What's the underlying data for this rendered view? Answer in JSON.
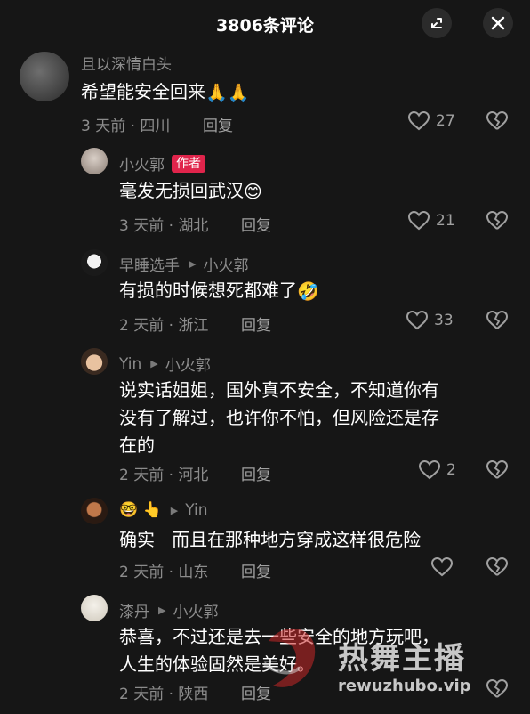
{
  "header": {
    "title": "3806条评论"
  },
  "comments": [
    {
      "user": "且以深情白头",
      "text": "希望能安全回来",
      "emoji": "🙏🙏",
      "meta": "3 天前 · 四川",
      "reply": "回复",
      "likes": "27"
    },
    {
      "user": "小火郭",
      "badge": "作者",
      "text": "毫发无损回武汉",
      "emoji": "😊",
      "meta": "3 天前 · 湖北",
      "reply": "回复",
      "likes": "21"
    },
    {
      "user": "早睡选手",
      "reply_to": "小火郭",
      "text": "有损的时候想死都难了",
      "emoji": "🤣",
      "meta": "2 天前 · 浙江",
      "reply": "回复",
      "likes": "33"
    },
    {
      "user": "Yin",
      "reply_to": "小火郭",
      "text_lines": [
        "说实话姐姐，国外真不安全，不知道你有",
        "没有了解过，也许你不怕，但风险还是存",
        "在的"
      ],
      "meta": "2 天前 · 河北",
      "reply": "回复",
      "likes": "2"
    },
    {
      "user": "🤓 👆",
      "reply_to": "Yin",
      "text": "确实   而且在那种地方穿成这样很危险",
      "meta": "2 天前 · 山东",
      "reply": "回复",
      "likes": ""
    },
    {
      "user": "漆丹",
      "reply_to": "小火郭",
      "text_lines": [
        "恭喜，不过还是去一些安全的地方玩吧，",
        "人生的体验固然是美好。"
      ],
      "meta": "2 天前 · 陕西",
      "reply": "回复",
      "likes": ""
    }
  ],
  "watermark": {
    "brand": "热舞主播",
    "url": "rewuzhubo.vip"
  },
  "colors": {
    "background": "#161616",
    "badge": "#e0244b",
    "muted": "#8c8c8c"
  },
  "icons": [
    "minimize-icon",
    "close-icon",
    "heart-icon",
    "broken-heart-icon",
    "reply-arrow-icon"
  ]
}
